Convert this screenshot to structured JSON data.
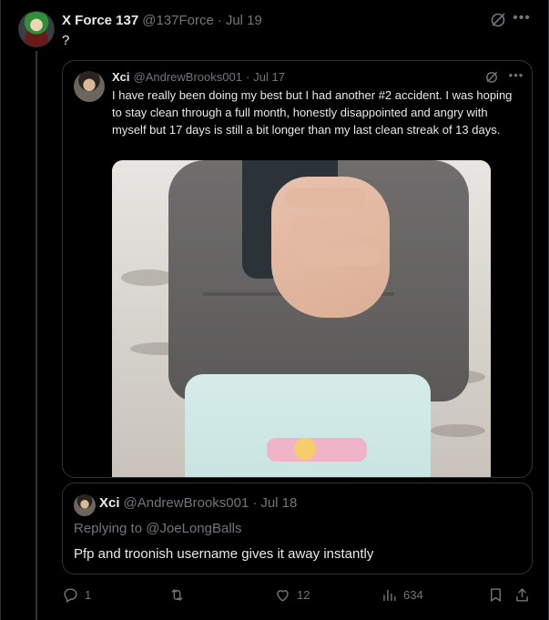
{
  "tweet": {
    "author_name": "X Force 137",
    "author_handle": "@137Force",
    "date": "Jul 19",
    "text": "?"
  },
  "quoted": {
    "author_name": "Xci",
    "author_handle": "@AndrewBrooks001",
    "date": "Jul 17",
    "text": "I have really been doing my best but I had another #2 accident. I was hoping to stay clean through a full month, honestly disappointed and angry with myself but 17 days is still a bit longer than my last clean streak of 13 days."
  },
  "reply": {
    "author_name": "Xci",
    "author_handle": "@AndrewBrooks001",
    "date": "Jul 18",
    "replying_to": "Replying to @JoeLongBalls",
    "text": "Pfp and troonish username gives it away instantly"
  },
  "actions": {
    "replies": "1",
    "retweets": "",
    "likes": "12",
    "views": "634"
  },
  "icons": {
    "reply": "reply-icon",
    "retweet": "retweet-icon",
    "like": "heart-icon",
    "views": "views-icon",
    "bookmark": "bookmark-icon",
    "share": "share-icon",
    "grok": "grok-icon",
    "more": "more-icon"
  }
}
